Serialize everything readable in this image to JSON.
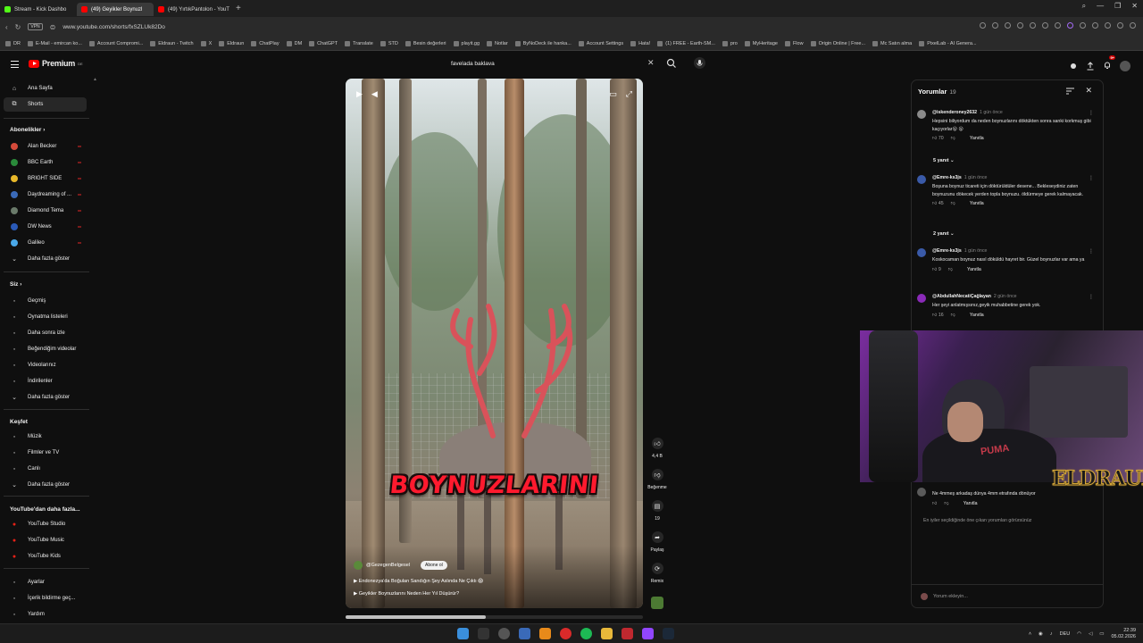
{
  "browser": {
    "tabs": [
      {
        "label": "Stream - Kick Dashbo",
        "color": "#53fc18",
        "active": false
      },
      {
        "label": "(49) Geyikler Boynuzl",
        "color": "#ff0000",
        "active": true
      },
      {
        "label": "(49) YırtıkPantolon - YouT",
        "color": "#ff0000",
        "active": false
      }
    ],
    "url": "www.youtube.com/shorts/fxSZLUk82Do",
    "vpn_label": "VPN",
    "bookmarks": [
      "DR",
      "E-Mail - emircan ko...",
      "Account Compromi...",
      "Eldraun - Twitch",
      "X",
      "Eldraun",
      "ChatPlay",
      "DM",
      "ChatGPT",
      "Translate",
      "STD",
      "Besin değerleri",
      "playit.gg",
      "Notlar",
      "ByNoDeck ile hanka...",
      "Account Settings",
      "Hata!",
      "(1) FREE - Earth-SM...",
      "pro",
      "MyHeritage",
      "Flow",
      "Origin Online | Free...",
      "Mc Satın alma",
      "PixelLab - AI Genera..."
    ],
    "all_bookmarks": "Tüm Yer İşaretleri"
  },
  "yt": {
    "logo_text": "Premium",
    "logo_country": "DE",
    "search_value": "favelada baklava",
    "notif_count": "9+"
  },
  "sidebar": {
    "main": [
      {
        "label": "Ana Sayfa",
        "icon": "home-icon",
        "active": false
      },
      {
        "label": "Shorts",
        "icon": "shorts-icon",
        "active": true
      }
    ],
    "subs_title": "Abonelikler",
    "subs": [
      {
        "label": "Alan Becker",
        "color": "#d44a3a"
      },
      {
        "label": "BBC Earth",
        "color": "#2a8a3a"
      },
      {
        "label": "BRIGHT SIDE",
        "color": "#e8b82a"
      },
      {
        "label": "Daydreaming of ...",
        "color": "#3a6ab8"
      },
      {
        "label": "Diamond Tema",
        "color": "#6a7a6a"
      },
      {
        "label": "DW News",
        "color": "#2a5ab8"
      },
      {
        "label": "Galileo",
        "color": "#4aa8e8"
      }
    ],
    "subs_more": "Daha fazla göster",
    "you_title": "Siz",
    "you": [
      {
        "label": "Geçmiş",
        "icon": "history-icon"
      },
      {
        "label": "Oynatma listeleri",
        "icon": "playlist-icon"
      },
      {
        "label": "Daha sonra izle",
        "icon": "clock-icon"
      },
      {
        "label": "Beğendiğim videolar",
        "icon": "like-icon"
      },
      {
        "label": "Videolarınız",
        "icon": "video-icon"
      },
      {
        "label": "İndirilenler",
        "icon": "download-icon"
      }
    ],
    "you_more": "Daha fazla göster",
    "explore_title": "Keşfet",
    "explore": [
      {
        "label": "Müzik",
        "icon": "music-icon"
      },
      {
        "label": "Filmler ve TV",
        "icon": "film-icon"
      },
      {
        "label": "Canlı",
        "icon": "live-icon"
      }
    ],
    "explore_more": "Daha fazla göster",
    "more_yt_title": "YouTube'dan daha fazla...",
    "more_yt": [
      {
        "label": "YouTube Studio"
      },
      {
        "label": "YouTube Music"
      },
      {
        "label": "YouTube Kids"
      }
    ],
    "footer": [
      {
        "label": "Ayarlar",
        "icon": "gear-icon"
      },
      {
        "label": "İçerik bildirme geç...",
        "icon": "flag-icon"
      },
      {
        "label": "Yardım",
        "icon": "help-icon"
      }
    ]
  },
  "video": {
    "caption": "BOYNUZLARINI",
    "channel": "@GezegenBelgesel",
    "subscribe_label": "Abone ol",
    "line1": "Endonezya'da Boğulan Sandığın Şey Aslında Ne Çıktı 😱",
    "line2": "Geyikler Boynuzlarını Neden Her Yıl Düşürür?",
    "progress": 0.47
  },
  "actions": {
    "likes": "4,4 B",
    "dislike_label": "Beğenme",
    "comments": "19",
    "share_label": "Paylaş",
    "remix_label": "Remix"
  },
  "comments": {
    "title": "Yorumlar",
    "count": "19",
    "items": [
      {
        "user": "@iskenderoney2632",
        "time": "1 gün önce",
        "text": "Hepsini biliyordum da neden boynuzlarını döktükten sonra sanki korkmuş gibi kaçıyorlar😮 😮",
        "likes": "70",
        "reply": "Yanıtla",
        "color": "#8a8a8a"
      },
      {
        "user": "@Emre-ks3js",
        "time": "1 gün önce",
        "text": "Boşuna boynuz ticareti için döktürüldüler desene... Bekleseydiniz zaten boynuzunu dökecek yerden topla boynuzu. öldürmeye gerek kalmayacak.",
        "likes": "45",
        "reply": "Yanıtla",
        "color": "#3a5aa8"
      },
      {
        "user": "@Emre-ks3js",
        "time": "1 gün önce",
        "text": "Koskocaman boynuz nasıl döküldü hayret bir. Güzel boynuzlar var ama ya",
        "likes": "9",
        "reply": "Yanıtla",
        "color": "#3a5aa8"
      },
      {
        "user": "@AbdullahNecatiÇağlayan",
        "time": "2 gün önce",
        "text": "Her şeyi anlatmışsınız,geyik muhabbetine gerek yok.",
        "likes": "16",
        "reply": "Yanıtla",
        "color": "#8a2ab8"
      },
      {
        "user": "",
        "time": "",
        "text": "Ne 4mmeş arkadaş dünya 4mm etrafında dönüyor",
        "likes": "",
        "reply": "Yanıtla",
        "color": "#5a5a5a"
      }
    ],
    "replies": [
      {
        "label": "5 yanıt"
      },
      {
        "label": "2 yanıt"
      }
    ],
    "hint": "En iyiler seçildiğinde öne çıkan yorumları görürsünüz",
    "input_placeholder": "Yorum ekleyin..."
  },
  "overlay": {
    "brand": "ELDRAUN",
    "shirt": "PUMA"
  },
  "taskbar": {
    "lang": "DEU",
    "time": "22:39",
    "date": "05.02.2026"
  }
}
